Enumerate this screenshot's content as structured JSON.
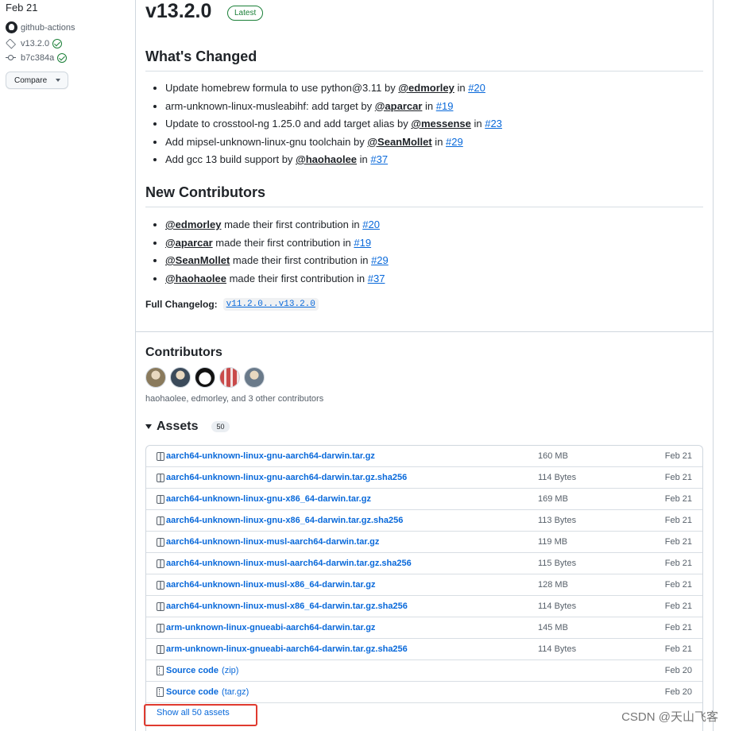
{
  "sidebar": {
    "date": "Feb 21",
    "author": "github-actions",
    "tag": "v13.2.0",
    "commit": "b7c384a",
    "compare_label": "Compare"
  },
  "release": {
    "version": "v13.2.0",
    "badge": "Latest"
  },
  "whats_changed": {
    "title": "What's Changed",
    "items": [
      {
        "text": "Update homebrew formula to use python@3.11 by ",
        "user": "@edmorley",
        "in": " in ",
        "pr": "#20"
      },
      {
        "text": "arm-unknown-linux-musleabihf: add target by ",
        "user": "@aparcar",
        "in": " in ",
        "pr": "#19"
      },
      {
        "text": "Update to crosstool-ng 1.25.0 and add target alias by ",
        "user": "@messense",
        "in": " in ",
        "pr": "#23"
      },
      {
        "text": "Add mipsel-unknown-linux-gnu toolchain by ",
        "user": "@SeanMollet",
        "in": " in ",
        "pr": "#29"
      },
      {
        "text": "Add gcc 13 build support by ",
        "user": "@haohaolee",
        "in": " in ",
        "pr": "#37"
      }
    ]
  },
  "new_contributors": {
    "title": "New Contributors",
    "items": [
      {
        "user": "@edmorley",
        "text": " made their first contribution in ",
        "pr": "#20"
      },
      {
        "user": "@aparcar",
        "text": " made their first contribution in ",
        "pr": "#19"
      },
      {
        "user": "@SeanMollet",
        "text": " made their first contribution in ",
        "pr": "#29"
      },
      {
        "user": "@haohaolee",
        "text": " made their first contribution in ",
        "pr": "#37"
      }
    ]
  },
  "changelog": {
    "label": "Full Changelog:",
    "link": "v11.2.0...v13.2.0"
  },
  "contributors": {
    "title": "Contributors",
    "summary": "haohaolee, edmorley, and 3 other contributors",
    "avatar_colors": [
      "#8a7a5c",
      "#3b4a5a",
      "#222222",
      "#c94a4a",
      "#6a7a8a"
    ]
  },
  "assets": {
    "title": "Assets",
    "count": "50",
    "rows": [
      {
        "icon": "package",
        "name": "aarch64-unknown-linux-gnu-aarch64-darwin.tar.gz",
        "size": "160 MB",
        "date": "Feb 21"
      },
      {
        "icon": "package",
        "name": "aarch64-unknown-linux-gnu-aarch64-darwin.tar.gz.sha256",
        "size": "114 Bytes",
        "date": "Feb 21"
      },
      {
        "icon": "package",
        "name": "aarch64-unknown-linux-gnu-x86_64-darwin.tar.gz",
        "size": "169 MB",
        "date": "Feb 21"
      },
      {
        "icon": "package",
        "name": "aarch64-unknown-linux-gnu-x86_64-darwin.tar.gz.sha256",
        "size": "113 Bytes",
        "date": "Feb 21"
      },
      {
        "icon": "package",
        "name": "aarch64-unknown-linux-musl-aarch64-darwin.tar.gz",
        "size": "119 MB",
        "date": "Feb 21"
      },
      {
        "icon": "package",
        "name": "aarch64-unknown-linux-musl-aarch64-darwin.tar.gz.sha256",
        "size": "115 Bytes",
        "date": "Feb 21"
      },
      {
        "icon": "package",
        "name": "aarch64-unknown-linux-musl-x86_64-darwin.tar.gz",
        "size": "128 MB",
        "date": "Feb 21"
      },
      {
        "icon": "package",
        "name": "aarch64-unknown-linux-musl-x86_64-darwin.tar.gz.sha256",
        "size": "114 Bytes",
        "date": "Feb 21"
      },
      {
        "icon": "package",
        "name": "arm-unknown-linux-gnueabi-aarch64-darwin.tar.gz",
        "size": "145 MB",
        "date": "Feb 21"
      },
      {
        "icon": "package",
        "name": "arm-unknown-linux-gnueabi-aarch64-darwin.tar.gz.sha256",
        "size": "114 Bytes",
        "date": "Feb 21"
      },
      {
        "icon": "zip",
        "name": "Source code",
        "sub": "(zip)",
        "size": "",
        "date": "Feb 20"
      },
      {
        "icon": "zip",
        "name": "Source code",
        "sub": "(tar.gz)",
        "size": "",
        "date": "Feb 20"
      }
    ],
    "show_all": "Show all 50 assets"
  },
  "watermark": "CSDN @天山飞客",
  "colors": {
    "link": "#0969da",
    "success": "#1a7f37",
    "highlight": "#e03a2f"
  }
}
